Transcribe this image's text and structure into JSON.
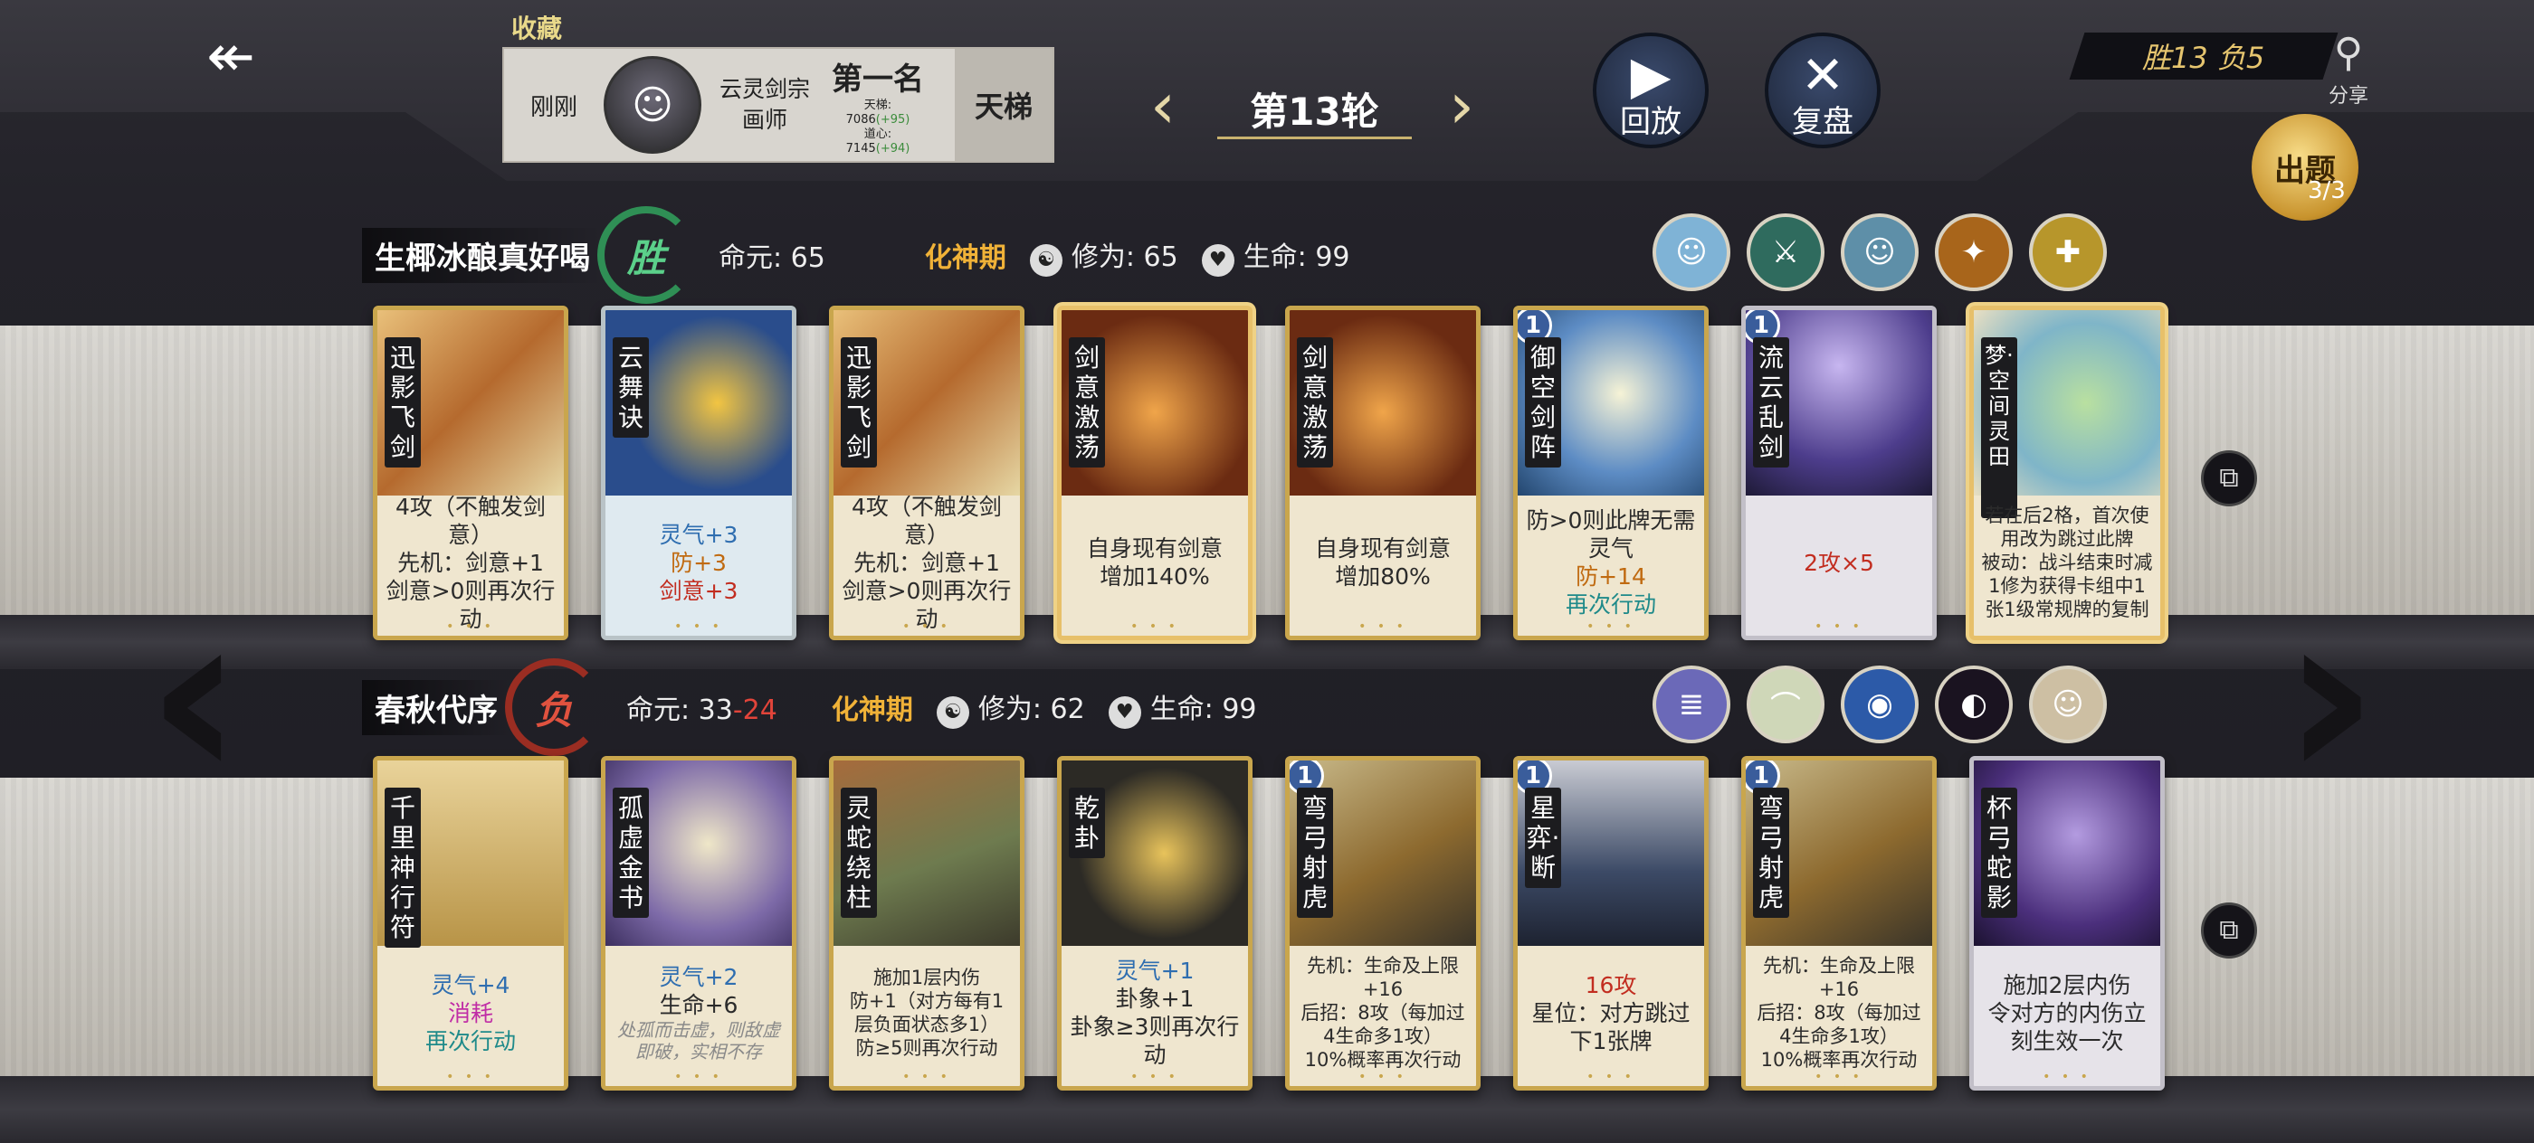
{
  "header": {
    "favorites_label": "收藏",
    "fav_card": {
      "time": "刚刚",
      "player_line1": "云灵剑宗",
      "player_line2": "画师",
      "rank": "第一名",
      "rank_detail1": "天梯:",
      "rank_detail2": "7086",
      "rank_detail2_delta": "(+95)",
      "rank_detail3": "道心:",
      "rank_detail4": "7145",
      "rank_detail4_delta": "(+94)",
      "ladder": "天梯"
    },
    "round": "第13轮",
    "replay_label": "回放",
    "review_label": "复盘",
    "record": "胜13 负5",
    "share_label": "分享",
    "quiz_label": "出题",
    "quiz_count": "3/3"
  },
  "player1": {
    "name": "生椰冰酿真好喝",
    "result": "胜",
    "life_base_label": "命元:",
    "life_base": "65",
    "stage": "化神期",
    "cultivation_label": "修为:",
    "cultivation": "65",
    "hp_label": "生命:",
    "hp": "99",
    "cards": [
      {
        "name": "迅影飞剑",
        "level": "",
        "desc": [
          "4攻（不触发剑意）",
          "先机：剑意+1",
          "剑意>0则再次行动"
        ]
      },
      {
        "name": "云舞诀",
        "level": "",
        "desc": [
          "灵气+3",
          "防+3",
          "剑意+3"
        ]
      },
      {
        "name": "迅影飞剑",
        "level": "",
        "desc": [
          "4攻（不触发剑意）",
          "先机：剑意+1",
          "剑意>0则再次行动"
        ]
      },
      {
        "name": "剑意激荡",
        "level": "",
        "desc": [
          "自身现有剑意",
          "增加140%"
        ]
      },
      {
        "name": "剑意激荡",
        "level": "",
        "desc": [
          "自身现有剑意",
          "增加80%"
        ]
      },
      {
        "name": "御空剑阵",
        "level": "1",
        "desc": [
          "防>0则此牌无需灵气",
          "防+14",
          "再次行动"
        ]
      },
      {
        "name": "流云乱剑",
        "level": "1",
        "desc": [
          "2攻×5"
        ]
      },
      {
        "name": "梦·空间灵田",
        "level": "",
        "desc": [
          "若在后2格，首次使用改为跳过此牌",
          "被动：战斗结束时减1修为获得卡组中1张1级常规牌的复制"
        ]
      }
    ]
  },
  "player2": {
    "name": "春秋代序",
    "result": "负",
    "life_base_label": "命元:",
    "life_base": "33",
    "life_base_delta": "-24",
    "stage": "化神期",
    "cultivation_label": "修为:",
    "cultivation": "62",
    "hp_label": "生命:",
    "hp": "99",
    "cards": [
      {
        "name": "千里神行符",
        "level": "",
        "desc": [
          "灵气+4",
          "消耗",
          "再次行动"
        ]
      },
      {
        "name": "孤虚金书",
        "level": "",
        "desc": [
          "灵气+2",
          "生命+6",
          "处孤而击虚，则敌虚即破，实相不存"
        ]
      },
      {
        "name": "灵蛇绕柱",
        "level": "",
        "desc": [
          "施加1层内伤",
          "防+1（对方每有1层负面状态多1）",
          "防≥5则再次行动"
        ]
      },
      {
        "name": "乾卦",
        "level": "",
        "desc": [
          "灵气+1",
          "卦象+1",
          "卦象≥3则再次行动"
        ]
      },
      {
        "name": "弯弓射虎",
        "level": "1",
        "desc": [
          "先机：生命及上限+16",
          "后招：8攻（每加过4生命多1攻）",
          "10%概率再次行动"
        ]
      },
      {
        "name": "星弈·断",
        "level": "1",
        "desc": [
          "16攻",
          "星位：对方跳过下1张牌"
        ]
      },
      {
        "name": "弯弓射虎",
        "level": "1",
        "desc": [
          "先机：生命及上限+16",
          "后招：8攻（每加过4生命多1攻）",
          "10%概率再次行动"
        ]
      },
      {
        "name": "杯弓蛇影",
        "level": "",
        "desc": [
          "施加2层内伤",
          "令对方的内伤立刻生效一次"
        ]
      }
    ]
  },
  "colors": {
    "accent_gold": "#c9a64d",
    "win_green": "#2f8f55",
    "lose_red": "#9a2d22",
    "stage_orange": "#f0b238"
  }
}
